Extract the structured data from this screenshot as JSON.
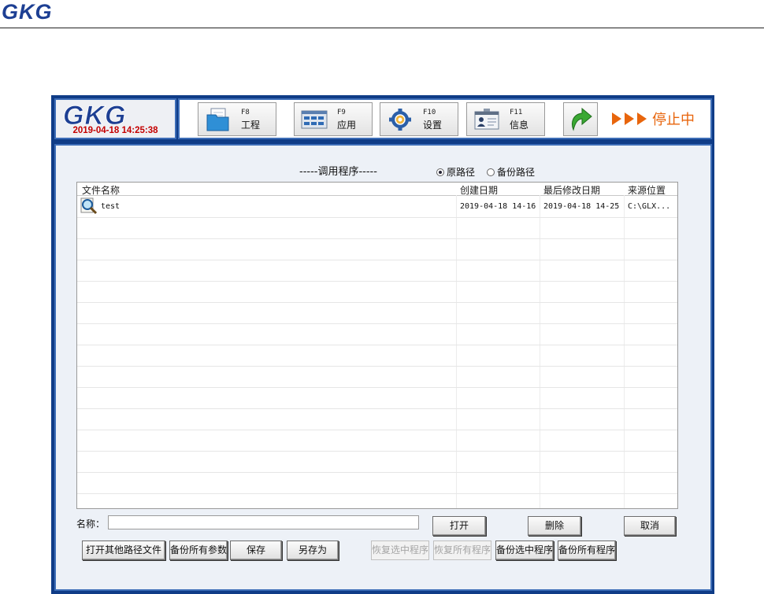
{
  "document": {
    "brand": "GKG"
  },
  "app": {
    "logo": "GKG",
    "datetime": "2019-04-18 14:25:38",
    "toolbar": [
      {
        "key": "F8",
        "label": "工程",
        "icon": "folder-icon"
      },
      {
        "key": "F9",
        "label": "应用",
        "icon": "application-grid-icon"
      },
      {
        "key": "F10",
        "label": "设置",
        "icon": "gear-icon"
      },
      {
        "key": "F11",
        "label": "信息",
        "icon": "id-card-icon"
      }
    ],
    "return_icon": "green-return-arrow-icon",
    "status": {
      "arrows": "▶▶▶",
      "text": "停止中"
    }
  },
  "panel": {
    "title": "-----调用程序-----",
    "path_options": [
      {
        "label": "原路径",
        "selected": true
      },
      {
        "label": "备份路径",
        "selected": false
      }
    ],
    "table": {
      "columns": [
        "文件名称",
        "创建日期",
        "最后修改日期",
        "来源位置"
      ],
      "rows": [
        {
          "name": "test",
          "created": "2019-04-18 14-16",
          "modified": "2019-04-18 14-25",
          "source": "C:\\GLX..."
        }
      ]
    },
    "name_label": "名称：",
    "name_value": "",
    "buttons": {
      "open": "打开",
      "delete": "删除",
      "cancel": "取消",
      "open_other": "打开其他路径文件",
      "backup_params": "备份所有参数",
      "save": "保存",
      "save_as": "另存为",
      "restore_selected": "恢复选中程序",
      "restore_all": "恢复所有程序",
      "backup_selected": "备份选中程序",
      "backup_all": "备份所有程序"
    }
  },
  "colors": {
    "frame": "#0f3c87",
    "panel_border": "#3d6db7",
    "clock": "#c40000",
    "status": "#e8650c",
    "logo_blue": "#1d3f93"
  }
}
